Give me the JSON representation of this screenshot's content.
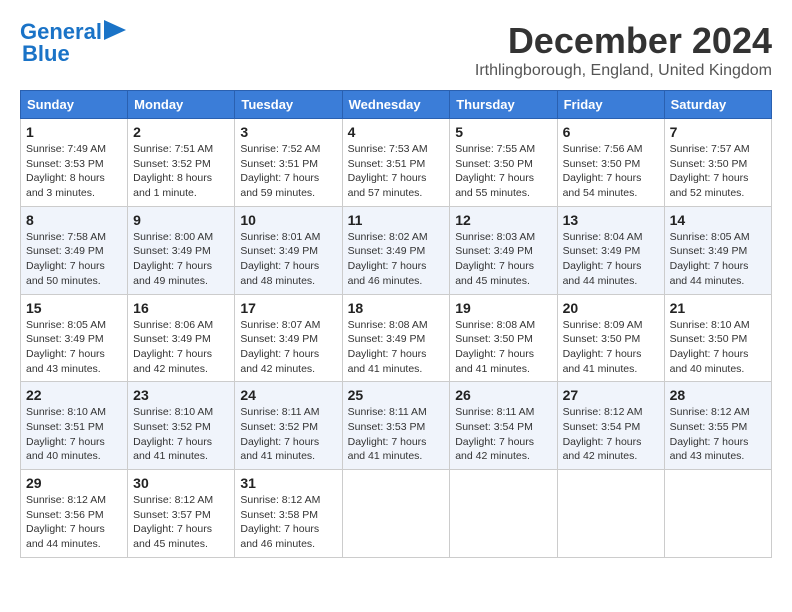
{
  "header": {
    "logo": {
      "line1": "General",
      "line2": "Blue"
    },
    "title": "December 2024",
    "location": "Irthlingborough, England, United Kingdom"
  },
  "weekdays": [
    "Sunday",
    "Monday",
    "Tuesday",
    "Wednesday",
    "Thursday",
    "Friday",
    "Saturday"
  ],
  "weeks": [
    [
      {
        "day": 1,
        "sunrise": "7:49 AM",
        "sunset": "3:53 PM",
        "daylight": "8 hours and 3 minutes."
      },
      {
        "day": 2,
        "sunrise": "7:51 AM",
        "sunset": "3:52 PM",
        "daylight": "8 hours and 1 minute."
      },
      {
        "day": 3,
        "sunrise": "7:52 AM",
        "sunset": "3:51 PM",
        "daylight": "7 hours and 59 minutes."
      },
      {
        "day": 4,
        "sunrise": "7:53 AM",
        "sunset": "3:51 PM",
        "daylight": "7 hours and 57 minutes."
      },
      {
        "day": 5,
        "sunrise": "7:55 AM",
        "sunset": "3:50 PM",
        "daylight": "7 hours and 55 minutes."
      },
      {
        "day": 6,
        "sunrise": "7:56 AM",
        "sunset": "3:50 PM",
        "daylight": "7 hours and 54 minutes."
      },
      {
        "day": 7,
        "sunrise": "7:57 AM",
        "sunset": "3:50 PM",
        "daylight": "7 hours and 52 minutes."
      }
    ],
    [
      {
        "day": 8,
        "sunrise": "7:58 AM",
        "sunset": "3:49 PM",
        "daylight": "7 hours and 50 minutes."
      },
      {
        "day": 9,
        "sunrise": "8:00 AM",
        "sunset": "3:49 PM",
        "daylight": "7 hours and 49 minutes."
      },
      {
        "day": 10,
        "sunrise": "8:01 AM",
        "sunset": "3:49 PM",
        "daylight": "7 hours and 48 minutes."
      },
      {
        "day": 11,
        "sunrise": "8:02 AM",
        "sunset": "3:49 PM",
        "daylight": "7 hours and 46 minutes."
      },
      {
        "day": 12,
        "sunrise": "8:03 AM",
        "sunset": "3:49 PM",
        "daylight": "7 hours and 45 minutes."
      },
      {
        "day": 13,
        "sunrise": "8:04 AM",
        "sunset": "3:49 PM",
        "daylight": "7 hours and 44 minutes."
      },
      {
        "day": 14,
        "sunrise": "8:05 AM",
        "sunset": "3:49 PM",
        "daylight": "7 hours and 44 minutes."
      }
    ],
    [
      {
        "day": 15,
        "sunrise": "8:05 AM",
        "sunset": "3:49 PM",
        "daylight": "7 hours and 43 minutes."
      },
      {
        "day": 16,
        "sunrise": "8:06 AM",
        "sunset": "3:49 PM",
        "daylight": "7 hours and 42 minutes."
      },
      {
        "day": 17,
        "sunrise": "8:07 AM",
        "sunset": "3:49 PM",
        "daylight": "7 hours and 42 minutes."
      },
      {
        "day": 18,
        "sunrise": "8:08 AM",
        "sunset": "3:49 PM",
        "daylight": "7 hours and 41 minutes."
      },
      {
        "day": 19,
        "sunrise": "8:08 AM",
        "sunset": "3:50 PM",
        "daylight": "7 hours and 41 minutes."
      },
      {
        "day": 20,
        "sunrise": "8:09 AM",
        "sunset": "3:50 PM",
        "daylight": "7 hours and 41 minutes."
      },
      {
        "day": 21,
        "sunrise": "8:10 AM",
        "sunset": "3:50 PM",
        "daylight": "7 hours and 40 minutes."
      }
    ],
    [
      {
        "day": 22,
        "sunrise": "8:10 AM",
        "sunset": "3:51 PM",
        "daylight": "7 hours and 40 minutes."
      },
      {
        "day": 23,
        "sunrise": "8:10 AM",
        "sunset": "3:52 PM",
        "daylight": "7 hours and 41 minutes."
      },
      {
        "day": 24,
        "sunrise": "8:11 AM",
        "sunset": "3:52 PM",
        "daylight": "7 hours and 41 minutes."
      },
      {
        "day": 25,
        "sunrise": "8:11 AM",
        "sunset": "3:53 PM",
        "daylight": "7 hours and 41 minutes."
      },
      {
        "day": 26,
        "sunrise": "8:11 AM",
        "sunset": "3:54 PM",
        "daylight": "7 hours and 42 minutes."
      },
      {
        "day": 27,
        "sunrise": "8:12 AM",
        "sunset": "3:54 PM",
        "daylight": "7 hours and 42 minutes."
      },
      {
        "day": 28,
        "sunrise": "8:12 AM",
        "sunset": "3:55 PM",
        "daylight": "7 hours and 43 minutes."
      }
    ],
    [
      {
        "day": 29,
        "sunrise": "8:12 AM",
        "sunset": "3:56 PM",
        "daylight": "7 hours and 44 minutes."
      },
      {
        "day": 30,
        "sunrise": "8:12 AM",
        "sunset": "3:57 PM",
        "daylight": "7 hours and 45 minutes."
      },
      {
        "day": 31,
        "sunrise": "8:12 AM",
        "sunset": "3:58 PM",
        "daylight": "7 hours and 46 minutes."
      },
      null,
      null,
      null,
      null
    ]
  ]
}
